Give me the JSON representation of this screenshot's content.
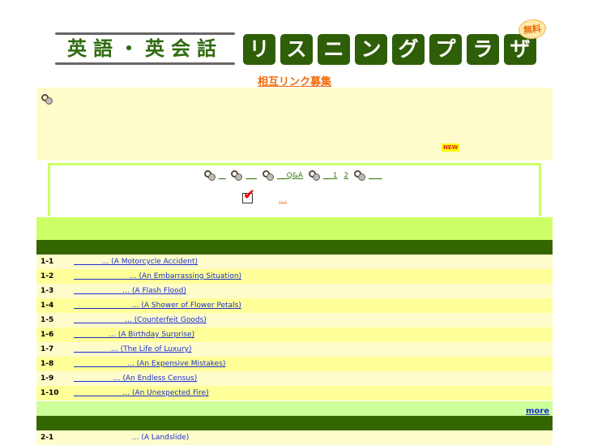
{
  "logo": {
    "left_text": "英語・英会話",
    "tiles": [
      "リ",
      "ス",
      "ニ",
      "ン",
      "グ",
      "プ",
      "ラ",
      "ザ"
    ],
    "badge": "無料"
  },
  "mutual_link": "相互リンク募集",
  "notice": {
    "new_badge": "NEW"
  },
  "nav": {
    "links": [
      "__",
      "___",
      "__ Q&A",
      "__ 1",
      "2",
      "__ _"
    ],
    "check_link": "…"
  },
  "section1": {
    "rows": [
      {
        "num": "1-1",
        "title": "            … (A Motorcycle Accident)"
      },
      {
        "num": "1-2",
        "title": "                        … (An Embarrassing Situation)"
      },
      {
        "num": "1-3",
        "title": "                     … (A Flash Flood)"
      },
      {
        "num": "1-4",
        "title": "                         … (A Shower of Flower Petals)"
      },
      {
        "num": "1-5",
        "title": "                      … (Counterfeit Goods)"
      },
      {
        "num": "1-6",
        "title": "               … (A Birthday Surprise)"
      },
      {
        "num": "1-7",
        "title": "                … (The Life of Luxury)"
      },
      {
        "num": "1-8",
        "title": "                       … (An Expensive Mistakes)"
      },
      {
        "num": "1-9",
        "title": "                 … (An Endless Census)"
      },
      {
        "num": "1-10",
        "title": "                     … (An Unexpected Fire)"
      }
    ],
    "more": "more"
  },
  "section2": {
    "rows": [
      {
        "num": "2-1",
        "title": "                         … (A Landslide)"
      }
    ]
  }
}
